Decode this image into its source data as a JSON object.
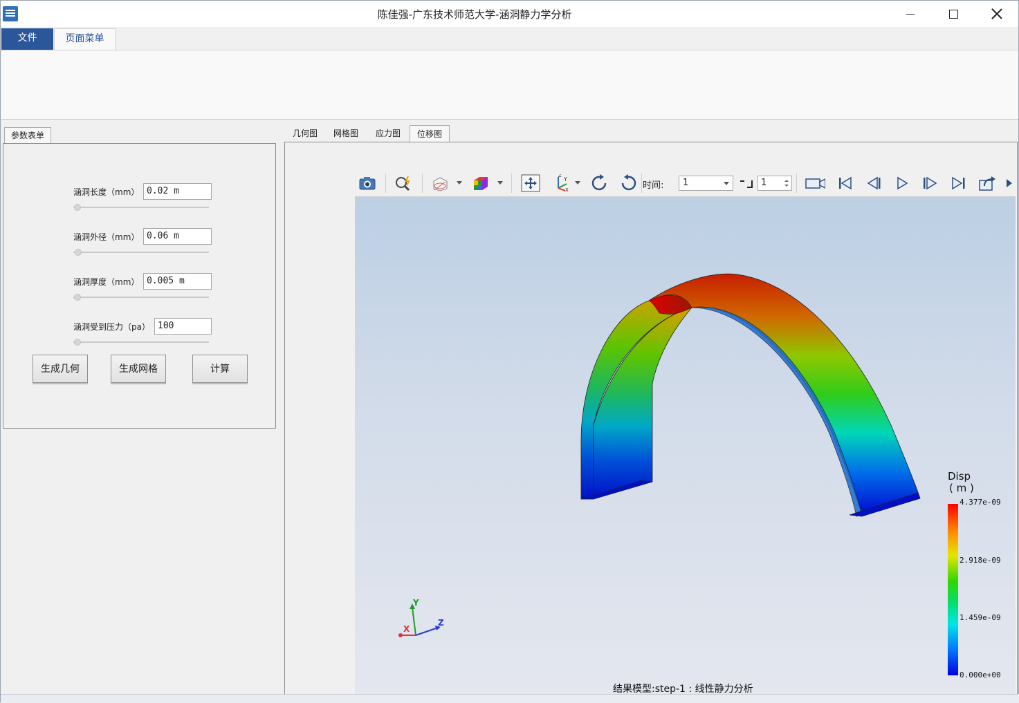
{
  "window": {
    "title": "陈佳强-广东技术师范大学-涵洞静力学分析"
  },
  "ribbon": {
    "tabs": [
      {
        "label": "文件"
      },
      {
        "label": "页面菜单"
      }
    ]
  },
  "param_panel": {
    "tab_label": "参数表单",
    "fields": [
      {
        "label": "涵洞长度（mm）",
        "value": "0.02 m"
      },
      {
        "label": "涵洞外径（mm）",
        "value": "0.06 m"
      },
      {
        "label": "涵洞厚度（mm）",
        "value": "0.005 m"
      },
      {
        "label": "涵洞受到压力（pa）",
        "value": "100"
      }
    ],
    "buttons": {
      "geometry": "生成几何",
      "mesh": "生成网格",
      "compute": "计算"
    }
  },
  "view_tabs": [
    {
      "label": "几何图"
    },
    {
      "label": "网格图"
    },
    {
      "label": "应力图"
    },
    {
      "label": "位移图"
    }
  ],
  "view_tabs_active": "位移图",
  "toolbar": {
    "time_label": "时间:",
    "time_value": "1",
    "step_value": "1"
  },
  "viewport": {
    "caption": "结果模型:step-1 : 线性静力分析",
    "axes": {
      "x": "X",
      "y": "Y",
      "z": "Z"
    },
    "legend": {
      "title": "Disp",
      "unit": "( m )",
      "ticks": [
        "4.377e-09",
        "2.918e-09",
        "1.459e-09",
        "0.000e+00"
      ]
    }
  },
  "colors": {
    "accent": "#2b579a",
    "legend_max": "#ff0000",
    "legend_min": "#0000e0"
  }
}
